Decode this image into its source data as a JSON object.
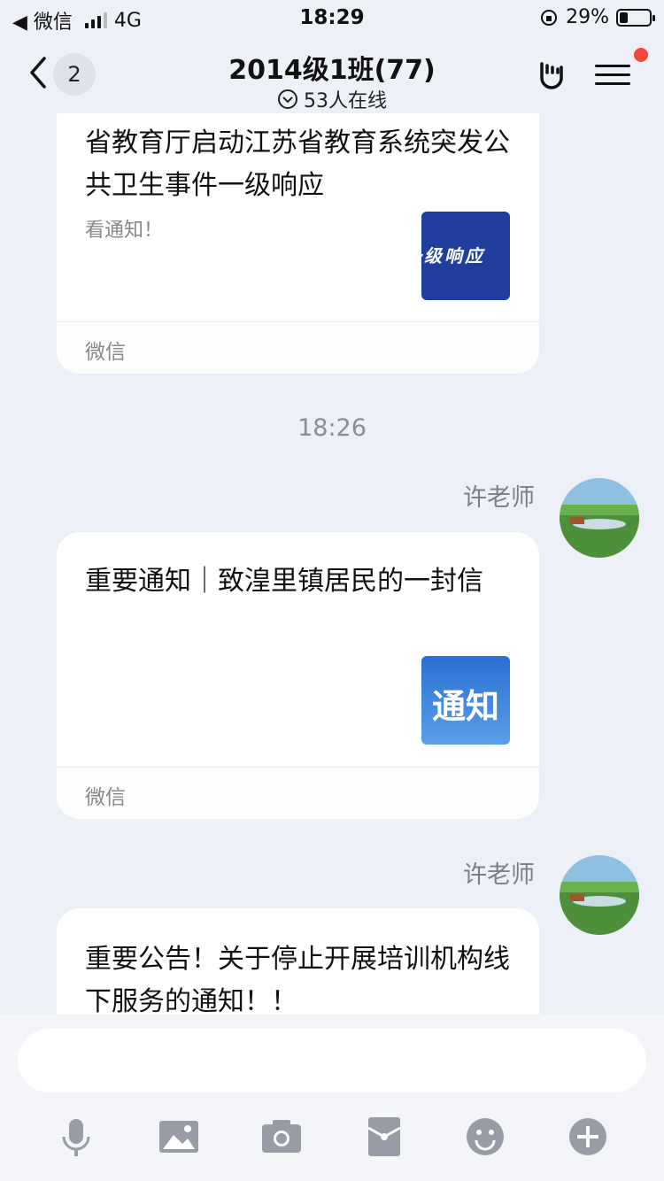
{
  "status_bar": {
    "back_app": "◀ 微信",
    "network": "4G",
    "time": "18:29",
    "battery": "29%",
    "battery_level": 0.29
  },
  "header": {
    "unread_count": "2",
    "title": "2014级1班(77)",
    "online": "53人在线"
  },
  "messages": [
    {
      "title": "省教育厅启动江苏省教育系统突发公共卫生事件一级响应",
      "desc": "看通知！",
      "thumb_text": "一级响应",
      "source": "微信"
    },
    {
      "sender": "许老师",
      "title": "重要通知｜致湟里镇居民的一封信",
      "thumb_text": "通知",
      "source": "微信"
    },
    {
      "sender": "许老师",
      "title": "重要公告！关于停止开展培训机构线下服务的通知！！"
    }
  ],
  "timestamp": "18:26",
  "input": {
    "placeholder": ""
  },
  "toolbar": [
    "mic-icon",
    "image-icon",
    "camera-icon",
    "red-packet-icon",
    "emoji-icon",
    "plus-icon"
  ],
  "colors": {
    "background": "#eef0f7",
    "card": "#ffffff",
    "badge": "#f4493a",
    "icon_gray": "#9a9ca5"
  }
}
